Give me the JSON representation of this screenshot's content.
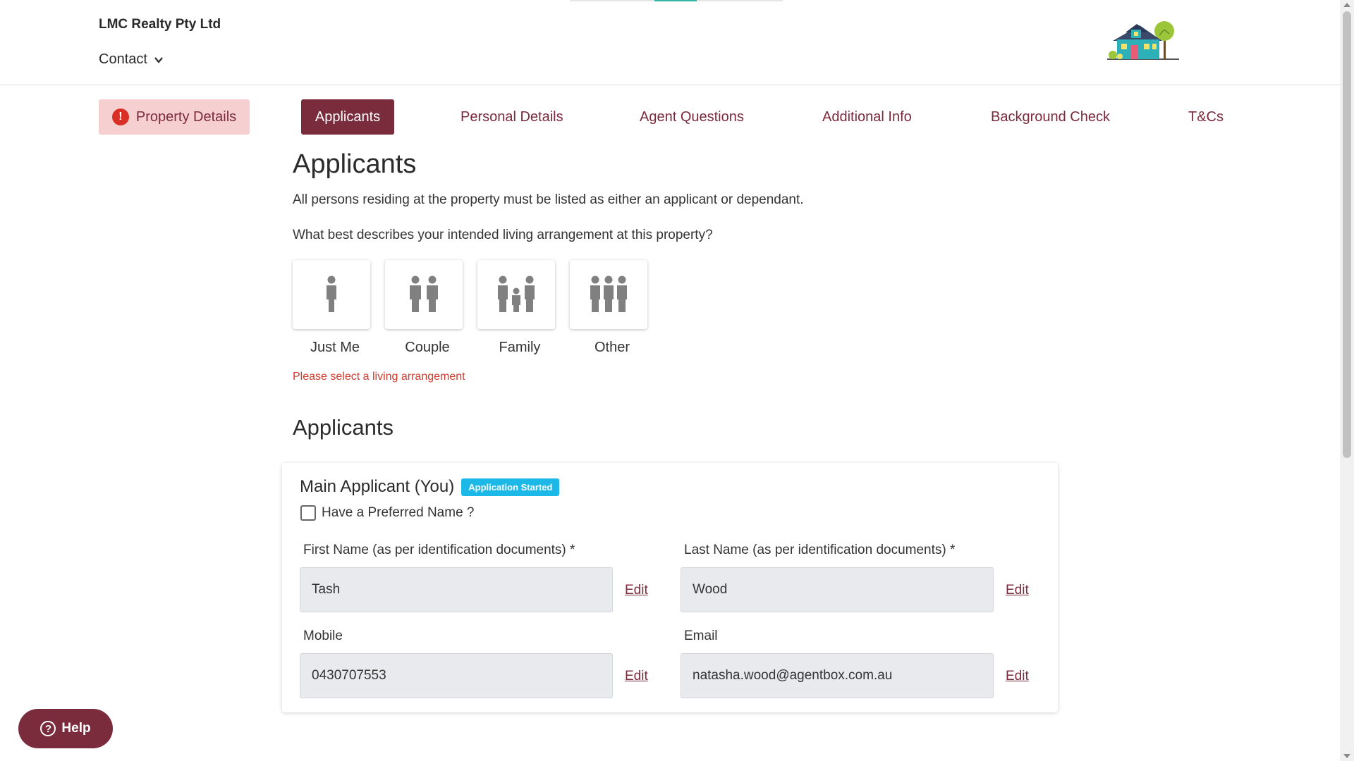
{
  "header": {
    "company": "LMC Realty Pty Ltd",
    "contact_label": "Contact"
  },
  "tabs": [
    {
      "label": "Property Details",
      "state": "error"
    },
    {
      "label": "Applicants",
      "state": "active"
    },
    {
      "label": "Personal Details"
    },
    {
      "label": "Agent Questions"
    },
    {
      "label": "Additional Info"
    },
    {
      "label": "Background Check"
    },
    {
      "label": "T&Cs"
    }
  ],
  "main": {
    "title": "Applicants",
    "description": "All persons residing at the property must be listed as either an applicant or dependant.",
    "question": "What best describes your intended living arrangement at this property?",
    "options": [
      "Just Me",
      "Couple",
      "Family",
      "Other"
    ],
    "error": "Please select a living arrangement",
    "section_title": "Applicants"
  },
  "applicant": {
    "title": "Main Applicant (You)",
    "badge": "Application Started",
    "preferred_name_label": "Have a Preferred Name ?",
    "first_name_label": "First Name (as per identification documents) *",
    "first_name": "Tash",
    "last_name_label": "Last Name (as per identification documents) *",
    "last_name": "Wood",
    "mobile_label": "Mobile",
    "mobile": "0430707553",
    "email_label": "Email",
    "email": "natasha.wood@agentbox.com.au",
    "edit_label": "Edit"
  },
  "help": {
    "label": "Help"
  },
  "colors": {
    "brand": "#7a2b3c",
    "error": "#d33a2c",
    "badge": "#1bb8e8",
    "tab_error_bg": "#f6cfd1"
  }
}
